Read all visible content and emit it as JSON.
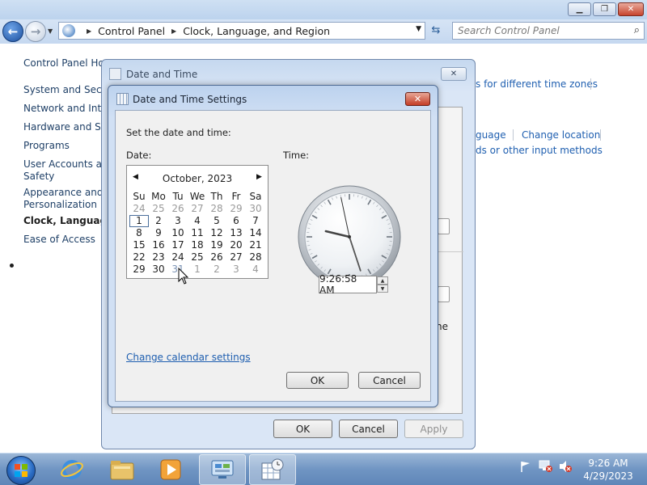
{
  "address": {
    "breadcrumb": [
      "Control Panel",
      "Clock, Language, and Region"
    ],
    "search_placeholder": "Search Control Panel"
  },
  "sidebar": {
    "items": [
      {
        "label": "Control Panel Home"
      },
      {
        "label": "System and Security"
      },
      {
        "label": "Network and Internet"
      },
      {
        "label": "Hardware and Sound"
      },
      {
        "label": "Programs"
      },
      {
        "label": "User Accounts and"
      },
      {
        "label": "Safety"
      },
      {
        "label": "Appearance and"
      },
      {
        "label": "Personalization"
      },
      {
        "label": "Clock, Language, and Region"
      },
      {
        "label": "Ease of Access"
      }
    ]
  },
  "content_links": {
    "time_zones": "s for different time zones",
    "language": "guage",
    "change_location": "Change location",
    "input_methods": "ds or other input methods",
    "ne": "ne"
  },
  "outer_dialog": {
    "title": "Date and Time",
    "ok": "OK",
    "cancel": "Cancel",
    "apply": "Apply"
  },
  "inner_dialog": {
    "title": "Date and Time Settings",
    "instruction": "Set the date and time:",
    "date_label": "Date:",
    "time_label": "Time:",
    "time_value": "9:26:58 AM",
    "change_calendar_link": "Change calendar settings",
    "ok": "OK",
    "cancel": "Cancel"
  },
  "calendar": {
    "month": "October, 2023",
    "weekdays": [
      "Su",
      "Mo",
      "Tu",
      "We",
      "Th",
      "Fr",
      "Sa"
    ],
    "days": [
      {
        "d": "24",
        "muted": true
      },
      {
        "d": "25",
        "muted": true
      },
      {
        "d": "26",
        "muted": true
      },
      {
        "d": "27",
        "muted": true
      },
      {
        "d": "28",
        "muted": true
      },
      {
        "d": "29",
        "muted": true
      },
      {
        "d": "30",
        "muted": true
      },
      {
        "d": "1",
        "today": true
      },
      {
        "d": "2"
      },
      {
        "d": "3"
      },
      {
        "d": "4"
      },
      {
        "d": "5"
      },
      {
        "d": "6"
      },
      {
        "d": "7"
      },
      {
        "d": "8"
      },
      {
        "d": "9"
      },
      {
        "d": "10"
      },
      {
        "d": "11"
      },
      {
        "d": "12"
      },
      {
        "d": "13"
      },
      {
        "d": "14"
      },
      {
        "d": "15"
      },
      {
        "d": "16"
      },
      {
        "d": "17"
      },
      {
        "d": "18"
      },
      {
        "d": "19"
      },
      {
        "d": "20"
      },
      {
        "d": "21"
      },
      {
        "d": "22"
      },
      {
        "d": "23"
      },
      {
        "d": "24"
      },
      {
        "d": "25"
      },
      {
        "d": "26"
      },
      {
        "d": "27"
      },
      {
        "d": "28"
      },
      {
        "d": "29"
      },
      {
        "d": "30"
      },
      {
        "d": "31",
        "selected": true
      },
      {
        "d": "1",
        "muted": true
      },
      {
        "d": "2",
        "muted": true
      },
      {
        "d": "3",
        "muted": true
      },
      {
        "d": "4",
        "muted": true
      }
    ]
  },
  "analog_clock": {
    "hour": 9,
    "minute": 26,
    "second": 58
  },
  "taskbar": {
    "time": "9:26 AM",
    "date": "4/29/2023",
    "items": [
      "start-orb-icon",
      "internet-explorer-icon",
      "file-explorer-icon",
      "media-player-icon",
      "control-panel-icon",
      "date-time-icon"
    ]
  },
  "colors": {
    "link": "#1f5fb0",
    "close_red": "#c43d26",
    "taskbar": "#6a90bf"
  }
}
